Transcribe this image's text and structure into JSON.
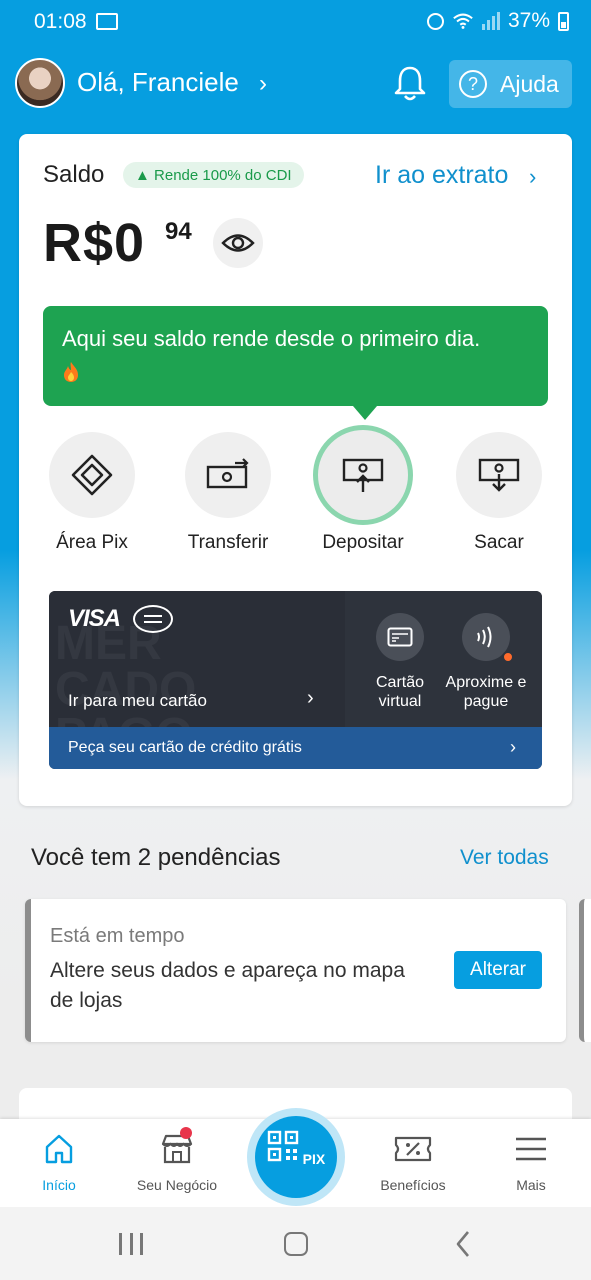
{
  "status_bar": {
    "time": "01:08",
    "battery": "37%"
  },
  "header": {
    "greeting": "Olá, Franciele",
    "help_label": "Ajuda"
  },
  "balance": {
    "title": "Saldo",
    "cdi_badge": "▲ Rende 100% do CDI",
    "statement_link": "Ir ao extrato",
    "currency": "R$",
    "amount_integer": "0",
    "amount_cents": "94",
    "tooltip_text": "Aqui seu saldo rende desde o primeiro dia."
  },
  "actions": [
    {
      "label": "Área Pix",
      "icon": "pix-icon"
    },
    {
      "label": "Transferir",
      "icon": "transfer-icon"
    },
    {
      "label": "Depositar",
      "icon": "deposit-icon"
    },
    {
      "label": "Sacar",
      "icon": "withdraw-icon"
    }
  ],
  "card_banner": {
    "brand": "VISA",
    "watermark": "MER\nCADO\nPAGO",
    "go_to_card": "Ir para meu cartão",
    "virtual_card": "Cartão virtual",
    "contactless": "Aproxime e pague",
    "credit_offer": "Peça seu cartão de crédito grátis"
  },
  "pendencies": {
    "title": "Você tem 2 pendências",
    "see_all": "Ver todas",
    "item": {
      "status": "Está em tempo",
      "text": "Altere seus dados e apareça no mapa de lojas",
      "button": "Alterar"
    }
  },
  "bottom_nav": {
    "home": "Início",
    "business": "Seu Negócio",
    "pix": "PIX",
    "benefits": "Benefícios",
    "more": "Mais"
  },
  "colors": {
    "brand_blue": "#069ee0",
    "tooltip_green": "#1ea351",
    "card_dark": "#2b2f38",
    "card_bottom_blue": "#235b99",
    "notification_red": "#e8354b"
  }
}
